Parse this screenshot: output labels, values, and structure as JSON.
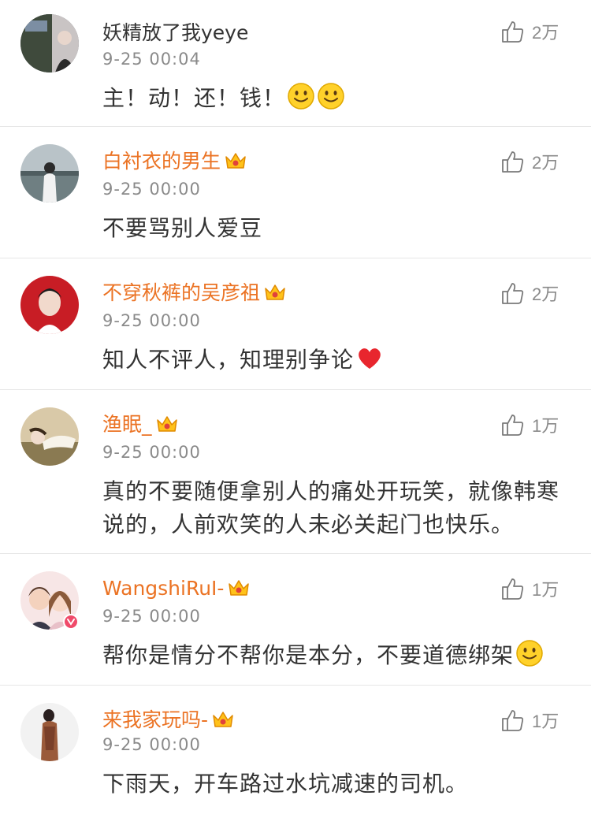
{
  "colors": {
    "vip_name": "#eb7324",
    "plain_name": "#333333",
    "meta": "#8a8a8a",
    "divider": "#e6e6e6"
  },
  "comments": [
    {
      "name": "妖精放了我yeye",
      "vip": false,
      "time": "9-25 00:04",
      "text": "主！动！还！钱！",
      "emoji": [
        "smile-emoji",
        "smile-emoji"
      ],
      "likes": "2万"
    },
    {
      "name": "白衬衣的男生",
      "vip": true,
      "time": "9-25 00:00",
      "text": "不要骂别人爱豆",
      "emoji": [],
      "likes": "2万"
    },
    {
      "name": "不穿秋裤的吴彦祖",
      "vip": true,
      "time": "9-25 00:00",
      "text": "知人不评人，知理别争论",
      "emoji": [
        "heart-emoji"
      ],
      "likes": "2万"
    },
    {
      "name": "渔眠_",
      "vip": true,
      "time": "9-25 00:00",
      "text": "真的不要随便拿别人的痛处开玩笑，就像韩寒说的，人前欢笑的人未必关起门也快乐。",
      "emoji": [],
      "likes": "1万"
    },
    {
      "name": "WangshiRuI-",
      "vip": true,
      "time": "9-25 00:00",
      "text": "帮你是情分不帮你是本分，不要道德绑架",
      "emoji": [
        "smile-emoji"
      ],
      "likes": "1万"
    },
    {
      "name": "来我家玩吗-",
      "vip": true,
      "time": "9-25 00:00",
      "text": "下雨天，开车路过水坑减速的司机。",
      "emoji": [],
      "likes": "1万"
    }
  ]
}
